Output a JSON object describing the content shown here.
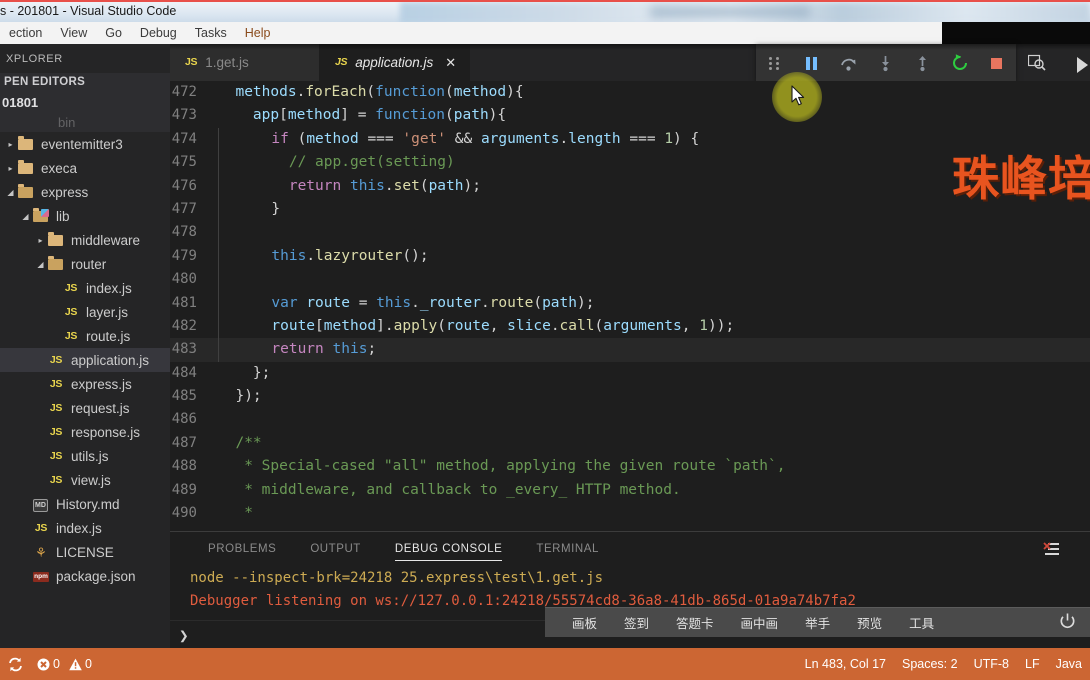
{
  "window": {
    "title": "s - 201801 - Visual Studio Code",
    "menu": [
      "ection",
      "View",
      "Go",
      "Debug",
      "Tasks",
      "Help"
    ]
  },
  "sidebar": {
    "title": "XPLORER",
    "open_editors": {
      "header": "PEN EDITORS",
      "folder": "01801"
    },
    "tree": [
      {
        "label": "eventemitter3",
        "kind": "folder",
        "state": "collapsed",
        "indent": 0
      },
      {
        "label": "execa",
        "kind": "folder",
        "state": "collapsed",
        "indent": 0
      },
      {
        "label": "express",
        "kind": "folder",
        "state": "expanded",
        "indent": 0
      },
      {
        "label": "lib",
        "kind": "folder-lib",
        "state": "expanded",
        "indent": 1
      },
      {
        "label": "middleware",
        "kind": "folder",
        "state": "collapsed",
        "indent": 2
      },
      {
        "label": "router",
        "kind": "folder",
        "state": "expanded",
        "indent": 2
      },
      {
        "label": "index.js",
        "kind": "js",
        "indent": 3
      },
      {
        "label": "layer.js",
        "kind": "js",
        "indent": 3
      },
      {
        "label": "route.js",
        "kind": "js",
        "indent": 3
      },
      {
        "label": "application.js",
        "kind": "js",
        "indent": 2,
        "selected": true
      },
      {
        "label": "express.js",
        "kind": "js",
        "indent": 2
      },
      {
        "label": "request.js",
        "kind": "js",
        "indent": 2
      },
      {
        "label": "response.js",
        "kind": "js",
        "indent": 2
      },
      {
        "label": "utils.js",
        "kind": "js",
        "indent": 2
      },
      {
        "label": "view.js",
        "kind": "js",
        "indent": 2
      },
      {
        "label": "History.md",
        "kind": "md",
        "indent": 1
      },
      {
        "label": "index.js",
        "kind": "js",
        "indent": 1
      },
      {
        "label": "LICENSE",
        "kind": "license",
        "indent": 1
      },
      {
        "label": "package.json",
        "kind": "pkg",
        "indent": 1
      }
    ]
  },
  "tabs": [
    {
      "label": "1.get.js",
      "active": false,
      "dirty": false
    },
    {
      "label": "application.js",
      "active": true,
      "dirty": false,
      "close": "✕"
    }
  ],
  "debug_toolbar": {
    "buttons": [
      {
        "name": "drag-handle",
        "title": "Drag"
      },
      {
        "name": "pause",
        "title": "Pause"
      },
      {
        "name": "step-over",
        "title": "Step Over"
      },
      {
        "name": "step-into",
        "title": "Step Into"
      },
      {
        "name": "step-out",
        "title": "Step Out"
      },
      {
        "name": "restart",
        "title": "Restart"
      },
      {
        "name": "stop",
        "title": "Stop"
      }
    ]
  },
  "editor": {
    "breakpoint_line": 481,
    "highlight_line": 483,
    "lines": [
      {
        "n": 472,
        "indent": 0,
        "guides": 0,
        "tokens": [
          {
            "t": "methods",
            "c": "vr"
          },
          {
            "t": ".",
            "c": "pn"
          },
          {
            "t": "forEach",
            "c": "fn"
          },
          {
            "t": "(",
            "c": "pn"
          },
          {
            "t": "function",
            "c": "k"
          },
          {
            "t": "(",
            "c": "pn"
          },
          {
            "t": "method",
            "c": "vr"
          },
          {
            "t": "){",
            "c": "pn"
          }
        ]
      },
      {
        "n": 473,
        "indent": 1,
        "guides": 0,
        "tokens": [
          {
            "t": "app",
            "c": "vr"
          },
          {
            "t": "[",
            "c": "pn"
          },
          {
            "t": "method",
            "c": "vr"
          },
          {
            "t": "] = ",
            "c": "pn"
          },
          {
            "t": "function",
            "c": "k"
          },
          {
            "t": "(",
            "c": "pn"
          },
          {
            "t": "path",
            "c": "vr"
          },
          {
            "t": "){",
            "c": "pn"
          }
        ]
      },
      {
        "n": 474,
        "indent": 2,
        "guides": 1,
        "tokens": [
          {
            "t": "if",
            "c": "kp"
          },
          {
            "t": " (",
            "c": "pn"
          },
          {
            "t": "method",
            "c": "vr"
          },
          {
            "t": " === ",
            "c": "pn"
          },
          {
            "t": "'get'",
            "c": "st"
          },
          {
            "t": " && ",
            "c": "pn"
          },
          {
            "t": "arguments",
            "c": "vr"
          },
          {
            "t": ".",
            "c": "pn"
          },
          {
            "t": "length",
            "c": "vr"
          },
          {
            "t": " === ",
            "c": "pn"
          },
          {
            "t": "1",
            "c": "nm"
          },
          {
            "t": ") {",
            "c": "pn"
          }
        ]
      },
      {
        "n": 475,
        "indent": 3,
        "guides": 2,
        "tokens": [
          {
            "t": "// app.get(setting)",
            "c": "cm"
          }
        ]
      },
      {
        "n": 476,
        "indent": 3,
        "guides": 2,
        "tokens": [
          {
            "t": "return",
            "c": "kp"
          },
          {
            "t": " ",
            "c": "pn"
          },
          {
            "t": "this",
            "c": "k"
          },
          {
            "t": ".",
            "c": "pn"
          },
          {
            "t": "set",
            "c": "fn"
          },
          {
            "t": "(",
            "c": "pn"
          },
          {
            "t": "path",
            "c": "vr"
          },
          {
            "t": ");",
            "c": "pn"
          }
        ]
      },
      {
        "n": 477,
        "indent": 2,
        "guides": 1,
        "tokens": [
          {
            "t": "}",
            "c": "pn"
          }
        ]
      },
      {
        "n": 478,
        "indent": 0,
        "guides": 1,
        "tokens": []
      },
      {
        "n": 479,
        "indent": 2,
        "guides": 1,
        "tokens": [
          {
            "t": "this",
            "c": "k"
          },
          {
            "t": ".",
            "c": "pn"
          },
          {
            "t": "lazyrouter",
            "c": "fn"
          },
          {
            "t": "();",
            "c": "pn"
          }
        ]
      },
      {
        "n": 480,
        "indent": 0,
        "guides": 1,
        "tokens": []
      },
      {
        "n": 481,
        "indent": 2,
        "guides": 1,
        "tokens": [
          {
            "t": "var",
            "c": "k"
          },
          {
            "t": " ",
            "c": "pn"
          },
          {
            "t": "route",
            "c": "vr"
          },
          {
            "t": " = ",
            "c": "pn"
          },
          {
            "t": "this",
            "c": "k"
          },
          {
            "t": ".",
            "c": "pn"
          },
          {
            "t": "_router",
            "c": "vr"
          },
          {
            "t": ".",
            "c": "pn"
          },
          {
            "t": "route",
            "c": "fn"
          },
          {
            "t": "(",
            "c": "pn"
          },
          {
            "t": "path",
            "c": "vr"
          },
          {
            "t": ");",
            "c": "pn"
          }
        ]
      },
      {
        "n": 482,
        "indent": 2,
        "guides": 1,
        "tokens": [
          {
            "t": "route",
            "c": "vr"
          },
          {
            "t": "[",
            "c": "pn"
          },
          {
            "t": "method",
            "c": "vr"
          },
          {
            "t": "].",
            "c": "pn"
          },
          {
            "t": "apply",
            "c": "fn"
          },
          {
            "t": "(",
            "c": "pn"
          },
          {
            "t": "route",
            "c": "vr"
          },
          {
            "t": ", ",
            "c": "pn"
          },
          {
            "t": "slice",
            "c": "vr"
          },
          {
            "t": ".",
            "c": "pn"
          },
          {
            "t": "call",
            "c": "fn"
          },
          {
            "t": "(",
            "c": "pn"
          },
          {
            "t": "arguments",
            "c": "vr"
          },
          {
            "t": ", ",
            "c": "pn"
          },
          {
            "t": "1",
            "c": "nm"
          },
          {
            "t": "));",
            "c": "pn"
          }
        ]
      },
      {
        "n": 483,
        "indent": 2,
        "guides": 1,
        "highlight": true,
        "tokens": [
          {
            "t": "return",
            "c": "kp"
          },
          {
            "t": " ",
            "c": "pn"
          },
          {
            "t": "this",
            "c": "k"
          },
          {
            "t": ";",
            "c": "pn"
          }
        ]
      },
      {
        "n": 484,
        "indent": 1,
        "guides": 0,
        "tokens": [
          {
            "t": "};",
            "c": "pn"
          }
        ]
      },
      {
        "n": 485,
        "indent": 0,
        "guides": 0,
        "tokens": [
          {
            "t": "});",
            "c": "pn"
          }
        ]
      },
      {
        "n": 486,
        "indent": 0,
        "guides": 0,
        "tokens": []
      },
      {
        "n": 487,
        "indent": 0,
        "guides": 0,
        "tokens": [
          {
            "t": "/**",
            "c": "cm"
          }
        ]
      },
      {
        "n": 488,
        "indent": 0,
        "guides": 0,
        "tokens": [
          {
            "t": " * Special-cased \"all\" method, applying the given route `path`,",
            "c": "cm"
          }
        ]
      },
      {
        "n": 489,
        "indent": 0,
        "guides": 0,
        "tokens": [
          {
            "t": " * middleware, and callback to _every_ HTTP method.",
            "c": "cm"
          }
        ]
      },
      {
        "n": 490,
        "indent": 0,
        "guides": 0,
        "tokens": [
          {
            "t": " *",
            "c": "cm"
          }
        ]
      }
    ]
  },
  "watermark": {
    "text": "珠峰培",
    "color": "#e8541f"
  },
  "panel": {
    "tabs": [
      {
        "label": "PROBLEMS",
        "active": false
      },
      {
        "label": "OUTPUT",
        "active": false
      },
      {
        "label": "DEBUG CONSOLE",
        "active": true
      },
      {
        "label": "TERMINAL",
        "active": false
      }
    ],
    "console_lines": [
      {
        "text": "node --inspect-brk=24218 25.express\\test\\1.get.js",
        "color": "#cdab53"
      },
      {
        "text": "Debugger listening on ws://127.0.0.1:24218/55574cd8-36a8-41db-865d-01a9a74b7fa2",
        "color": "#e05c3e"
      }
    ],
    "input_prompt": "❯",
    "input_value": ""
  },
  "float_toolbar": {
    "items": [
      "画板",
      "签到",
      "答题卡",
      "画中画",
      "举手",
      "预览",
      "工具"
    ],
    "power_icon": "power-icon"
  },
  "statusbar": {
    "background": "#cc6633",
    "sync_icon": "sync-icon",
    "errors": "0",
    "warnings": "0",
    "right": [
      "Ln 483, Col 17",
      "Spaces: 2",
      "UTF-8",
      "LF",
      "Java"
    ]
  }
}
